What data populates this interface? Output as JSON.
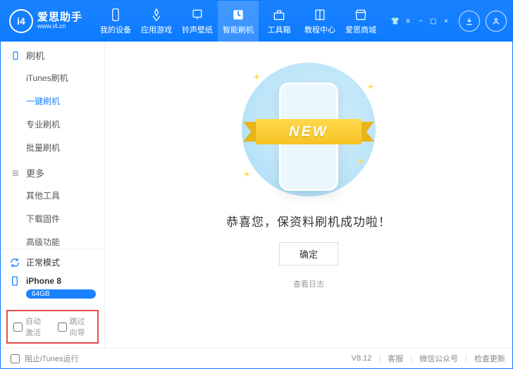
{
  "header": {
    "logo_letters": "i4",
    "app_name": "爱思助手",
    "app_url": "www.i4.cn",
    "nav": [
      {
        "label": "我的设备",
        "icon": "phone"
      },
      {
        "label": "应用游戏",
        "icon": "apps"
      },
      {
        "label": "铃声壁纸",
        "icon": "music"
      },
      {
        "label": "智能刷机",
        "icon": "flash",
        "active": true
      },
      {
        "label": "工具箱",
        "icon": "toolbox"
      },
      {
        "label": "教程中心",
        "icon": "book"
      },
      {
        "label": "爱思商城",
        "icon": "shop"
      }
    ]
  },
  "sidebar": {
    "groups": [
      {
        "title": "刷机",
        "icon": "phone-outline",
        "items": [
          {
            "label": "iTunes刷机"
          },
          {
            "label": "一键刷机",
            "active": true
          },
          {
            "label": "专业刷机"
          },
          {
            "label": "批量刷机"
          }
        ]
      },
      {
        "title": "更多",
        "icon": "menu",
        "items": [
          {
            "label": "其他工具"
          },
          {
            "label": "下载固件"
          },
          {
            "label": "高级功能"
          }
        ]
      }
    ],
    "mode_label": "正常模式",
    "device_name": "iPhone 8",
    "storage": "64GB",
    "check_auto_activate": "自动激活",
    "check_skip_guide": "跳过向导"
  },
  "main": {
    "ribbon_text": "NEW",
    "message": "恭喜您，保资料刷机成功啦！",
    "ok_button": "确定",
    "log_link": "查看日志"
  },
  "statusbar": {
    "block_itunes": "阻止iTunes运行",
    "version": "V8.12",
    "links": [
      "客服",
      "微信公众号",
      "检查更新"
    ]
  }
}
